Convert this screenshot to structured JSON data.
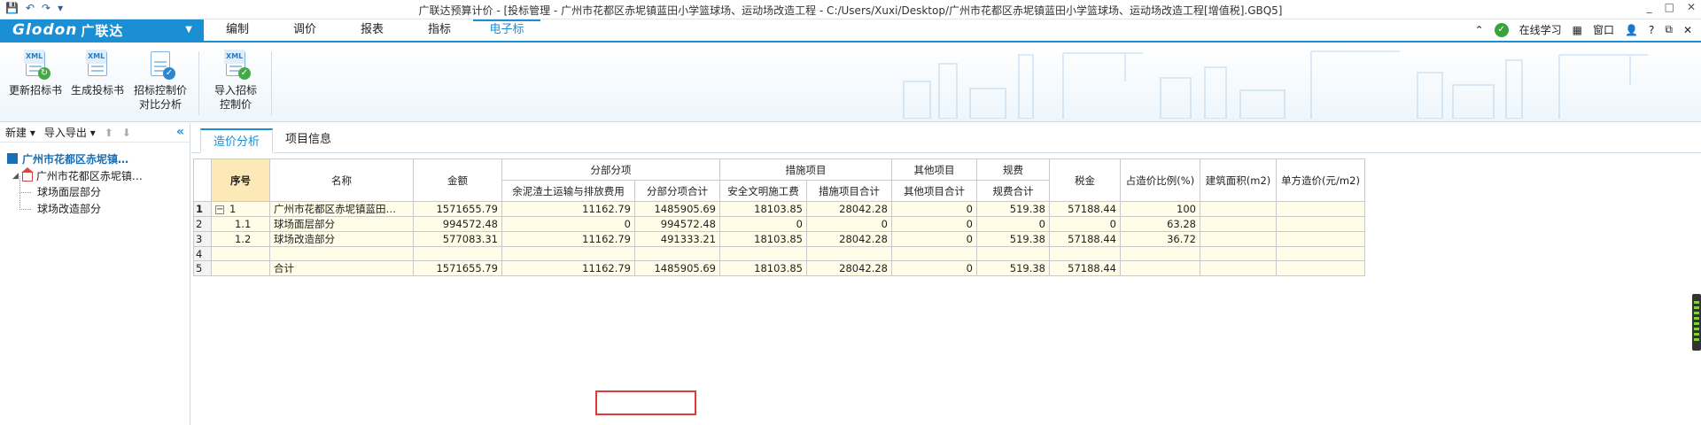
{
  "titlebar": {
    "title": "广联达预算计价 - [投标管理 - 广州市花都区赤坭镇蓝田小学篮球场、运动场改造工程 - C:/Users/Xuxi/Desktop/广州市花都区赤坭镇蓝田小学篮球场、运动场改造工程[增值税].GBQ5]",
    "window_controls": [
      "_",
      "□",
      "✕"
    ]
  },
  "menubar": {
    "logo": "Glodon",
    "logo_cn": "广联达",
    "menus": [
      "编制",
      "调价",
      "报表",
      "指标",
      "电子标"
    ],
    "active_menu": "电子标",
    "online_learning": "在线学习",
    "window_menu": "窗口"
  },
  "ribbon": {
    "buttons": [
      {
        "label": "更新招标书"
      },
      {
        "label": "生成投标书"
      },
      {
        "label_line1": "招标控制价",
        "label_line2": "对比分析"
      },
      {
        "label_line1": "导入招标",
        "label_line2": "控制价"
      }
    ]
  },
  "leftpanel": {
    "new_label": "新建",
    "import_export_label": "导入导出",
    "root": "广州市花都区赤坭镇…",
    "project": "广州市花都区赤坭镇…",
    "children": [
      "球场面层部分",
      "球场改造部分"
    ]
  },
  "main": {
    "tabs": [
      "造价分析",
      "项目信息"
    ],
    "active_tab": "造价分析"
  },
  "grid": {
    "headers": {
      "seq": "序号",
      "name": "名称",
      "amount": "金额",
      "fenbu_group": "分部分项",
      "fenbu_col1": "余泥渣土运输与排放费用",
      "fenbu_col2": "分部分项合计",
      "cuoshi_group": "措施项目",
      "cuoshi_col1": "安全文明施工费",
      "cuoshi_col2": "措施项目合计",
      "other_group": "其他项目",
      "other_col1": "其他项目合计",
      "guifei_group": "规费",
      "guifei_col1": "规费合计",
      "tax": "税金",
      "ratio": "占造价比例(%)",
      "area": "建筑面积(m2)",
      "unit_cost": "单方造价(元/m2)"
    },
    "rows": [
      {
        "rownum": "1",
        "seq": "1",
        "name": "广州市花都区赤坭镇蓝田…",
        "amount": "1571655.79",
        "f1": "11162.79",
        "f2": "1485905.69",
        "c1": "18103.85",
        "c2": "28042.28",
        "o1": "0",
        "g1": "519.38",
        "tax": "57188.44",
        "ratio": "100",
        "area": "",
        "unit": ""
      },
      {
        "rownum": "2",
        "seq": "1.1",
        "name": "球场面层部分",
        "amount": "994572.48",
        "f1": "0",
        "f2": "994572.48",
        "c1": "0",
        "c2": "0",
        "o1": "0",
        "g1": "0",
        "tax": "0",
        "ratio": "63.28",
        "area": "",
        "unit": ""
      },
      {
        "rownum": "3",
        "seq": "1.2",
        "name": "球场改造部分",
        "amount": "577083.31",
        "f1": "11162.79",
        "f2": "491333.21",
        "c1": "18103.85",
        "c2": "28042.28",
        "o1": "0",
        "g1": "519.38",
        "tax": "57188.44",
        "ratio": "36.72",
        "area": "",
        "unit": ""
      },
      {
        "rownum": "4",
        "seq": "",
        "name": "",
        "amount": "",
        "f1": "",
        "f2": "",
        "c1": "",
        "c2": "",
        "o1": "",
        "g1": "",
        "tax": "",
        "ratio": "",
        "area": "",
        "unit": ""
      },
      {
        "rownum": "5",
        "seq": "",
        "name": "合计",
        "amount": "1571655.79",
        "f1": "11162.79",
        "f2": "1485905.69",
        "c1": "18103.85",
        "c2": "28042.28",
        "o1": "0",
        "g1": "519.38",
        "tax": "57188.44",
        "ratio": "",
        "area": "",
        "unit": ""
      }
    ]
  },
  "colors": {
    "accent": "#1a8fd4",
    "seq_header": "#fde9b8",
    "data_area": "#fffde8",
    "highlight": "#e03a3a"
  }
}
